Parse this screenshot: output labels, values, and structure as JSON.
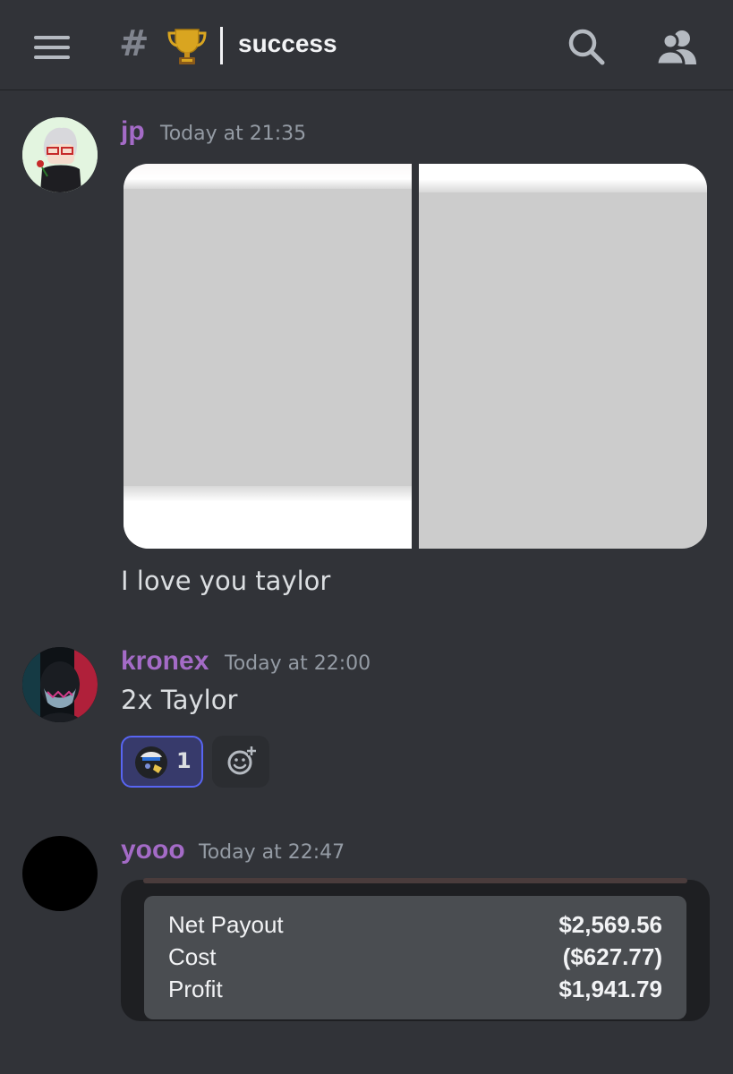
{
  "header": {
    "channel_hash": "#",
    "channel_name": "success"
  },
  "messages": [
    {
      "username": "jp",
      "timestamp": "Today at 21:35",
      "text": "I love you taylor",
      "attachments": 2
    },
    {
      "username": "kronex",
      "timestamp": "Today at 22:00",
      "text": "2x Taylor",
      "reaction": {
        "count": "1"
      }
    },
    {
      "username": "yooo",
      "timestamp": "Today at 22:47",
      "embed": {
        "rows": [
          {
            "label": "Net Payout",
            "value": "$2,569.56"
          },
          {
            "label": "Cost",
            "value": "($627.77)"
          },
          {
            "label": "Profit",
            "value": "$1,941.79"
          }
        ]
      }
    }
  ],
  "colors": {
    "background": "#313338",
    "username": "#a46bc7",
    "reaction_border": "#5865f2"
  },
  "icons": [
    "menu-icon",
    "hash-icon",
    "trophy-icon",
    "search-icon",
    "members-icon",
    "add-reaction-icon"
  ]
}
